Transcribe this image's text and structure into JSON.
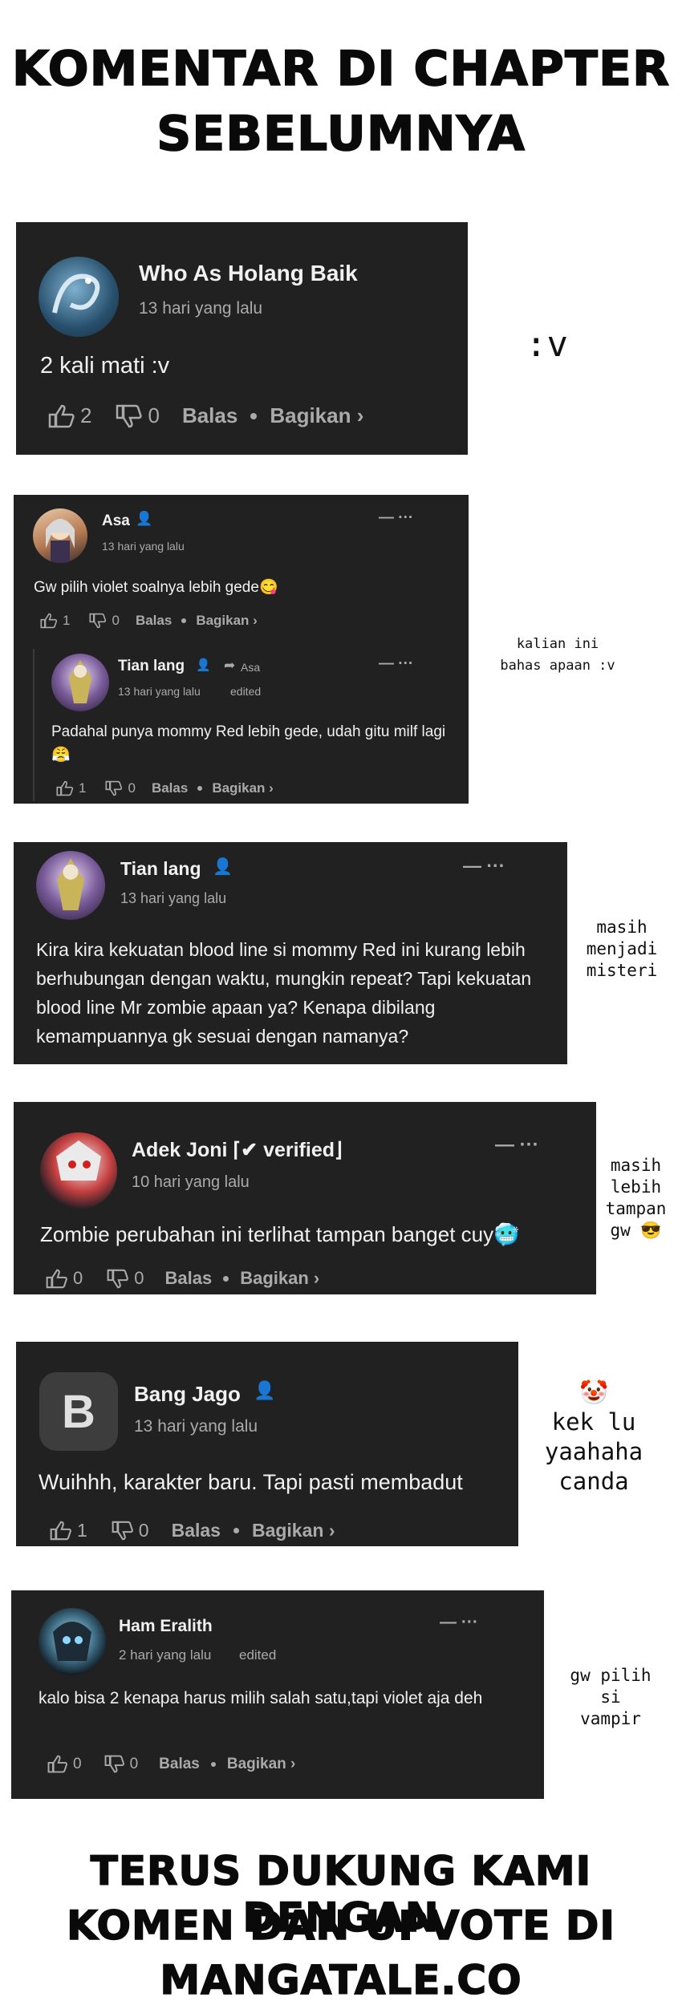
{
  "header": {
    "line1": "KOMENTAR DI CHAPTER",
    "line2": "SEBELUMNYA"
  },
  "footer": {
    "line1": "TERUS DUKUNG KAMI DENGAN",
    "line2": "KOMEN DAN UPVOTE DI",
    "line3": "MANGATALE.CO"
  },
  "comments": {
    "c1": {
      "name": "Who As Holang Baik",
      "time": "13 hari yang lalu",
      "text": "2 kali mati :v",
      "likes": "2",
      "dislikes": "0",
      "reply": "Balas",
      "share": "Bagikan ›",
      "side": ":v"
    },
    "c2": {
      "name": "Asa",
      "time": "13 hari yang lalu",
      "text": "Gw pilih violet soalnya lebih gede😋",
      "likes": "1",
      "dislikes": "0",
      "reply": "Balas",
      "share": "Bagikan ›",
      "sub": {
        "name": "Tian lang",
        "reply_to": "Asa",
        "time": "13 hari yang lalu",
        "edited": "edited",
        "text": "Padahal punya mommy Red lebih gede, udah gitu milf lagi 😤",
        "likes": "1",
        "dislikes": "0",
        "reply": "Balas",
        "share": "Bagikan ›"
      },
      "side_line1": "kalian ini",
      "side_line2": "bahas apaan :v"
    },
    "c3": {
      "name": "Tian lang",
      "time": "13 hari yang lalu",
      "text": "Kira kira kekuatan blood line si mommy Red ini kurang lebih berhubungan dengan waktu, mungkin repeat? Tapi kekuatan blood line Mr zombie apaan ya? Kenapa dibilang kemampuannya gk sesuai dengan namanya?",
      "side_line1": "masih",
      "side_line2": "menjadi",
      "side_line3": "misteri"
    },
    "c4": {
      "name": "Adek Joni ⌈✔ verified⌋",
      "time": "10 hari yang lalu",
      "text": "Zombie perubahan ini terlihat tampan banget cuy🥶",
      "likes": "0",
      "dislikes": "0",
      "reply": "Balas",
      "share": "Bagikan ›",
      "side_line1": "masih",
      "side_line2": "lebih",
      "side_line3": "tampan",
      "side_line4": "gw 😎"
    },
    "c5": {
      "avatar_letter": "B",
      "name": "Bang Jago",
      "time": "13 hari yang lalu",
      "text": "Wuihhh, karakter baru. Tapi pasti membadut",
      "likes": "1",
      "dislikes": "0",
      "reply": "Balas",
      "share": "Bagikan ›",
      "side_line1": "🤡",
      "side_line2": "kek lu",
      "side_line3": "yaahaha",
      "side_line4": "canda"
    },
    "c6": {
      "name": "Ham Eralith",
      "time": "2 hari yang lalu",
      "edited": "edited",
      "text": "kalo bisa 2 kenapa harus milih salah satu,tapi violet aja deh",
      "likes": "0",
      "dislikes": "0",
      "reply": "Balas",
      "share": "Bagikan ›",
      "side_line1": "gw pilih",
      "side_line2": "si",
      "side_line3": "vampir"
    }
  },
  "menu_glyph": "— ···",
  "colors": {
    "card_bg": "#212121",
    "text": "#f1f1f1",
    "muted": "#aaaaaa",
    "page_bg": "#ffffff"
  }
}
